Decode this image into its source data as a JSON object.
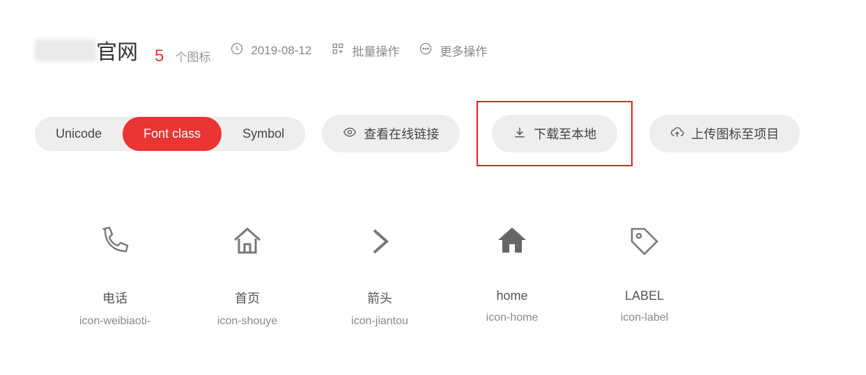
{
  "header": {
    "title_suffix": "官网",
    "count": "5",
    "count_label": "个图标",
    "date": "2019-08-12",
    "batch_label": "批量操作",
    "more_label": "更多操作"
  },
  "toolbar": {
    "tabs": {
      "unicode": "Unicode",
      "fontclass": "Font class",
      "symbol": "Symbol"
    },
    "view_link": "查看在线链接",
    "download": "下载至本地",
    "upload": "上传图标至项目"
  },
  "icons": [
    {
      "title": "电话",
      "code": "icon-weibiaoti-"
    },
    {
      "title": "首页",
      "code": "icon-shouye"
    },
    {
      "title": "箭头",
      "code": "icon-jiantou"
    },
    {
      "title": "home",
      "code": "icon-home"
    },
    {
      "title": "LABEL",
      "code": "icon-label"
    }
  ]
}
